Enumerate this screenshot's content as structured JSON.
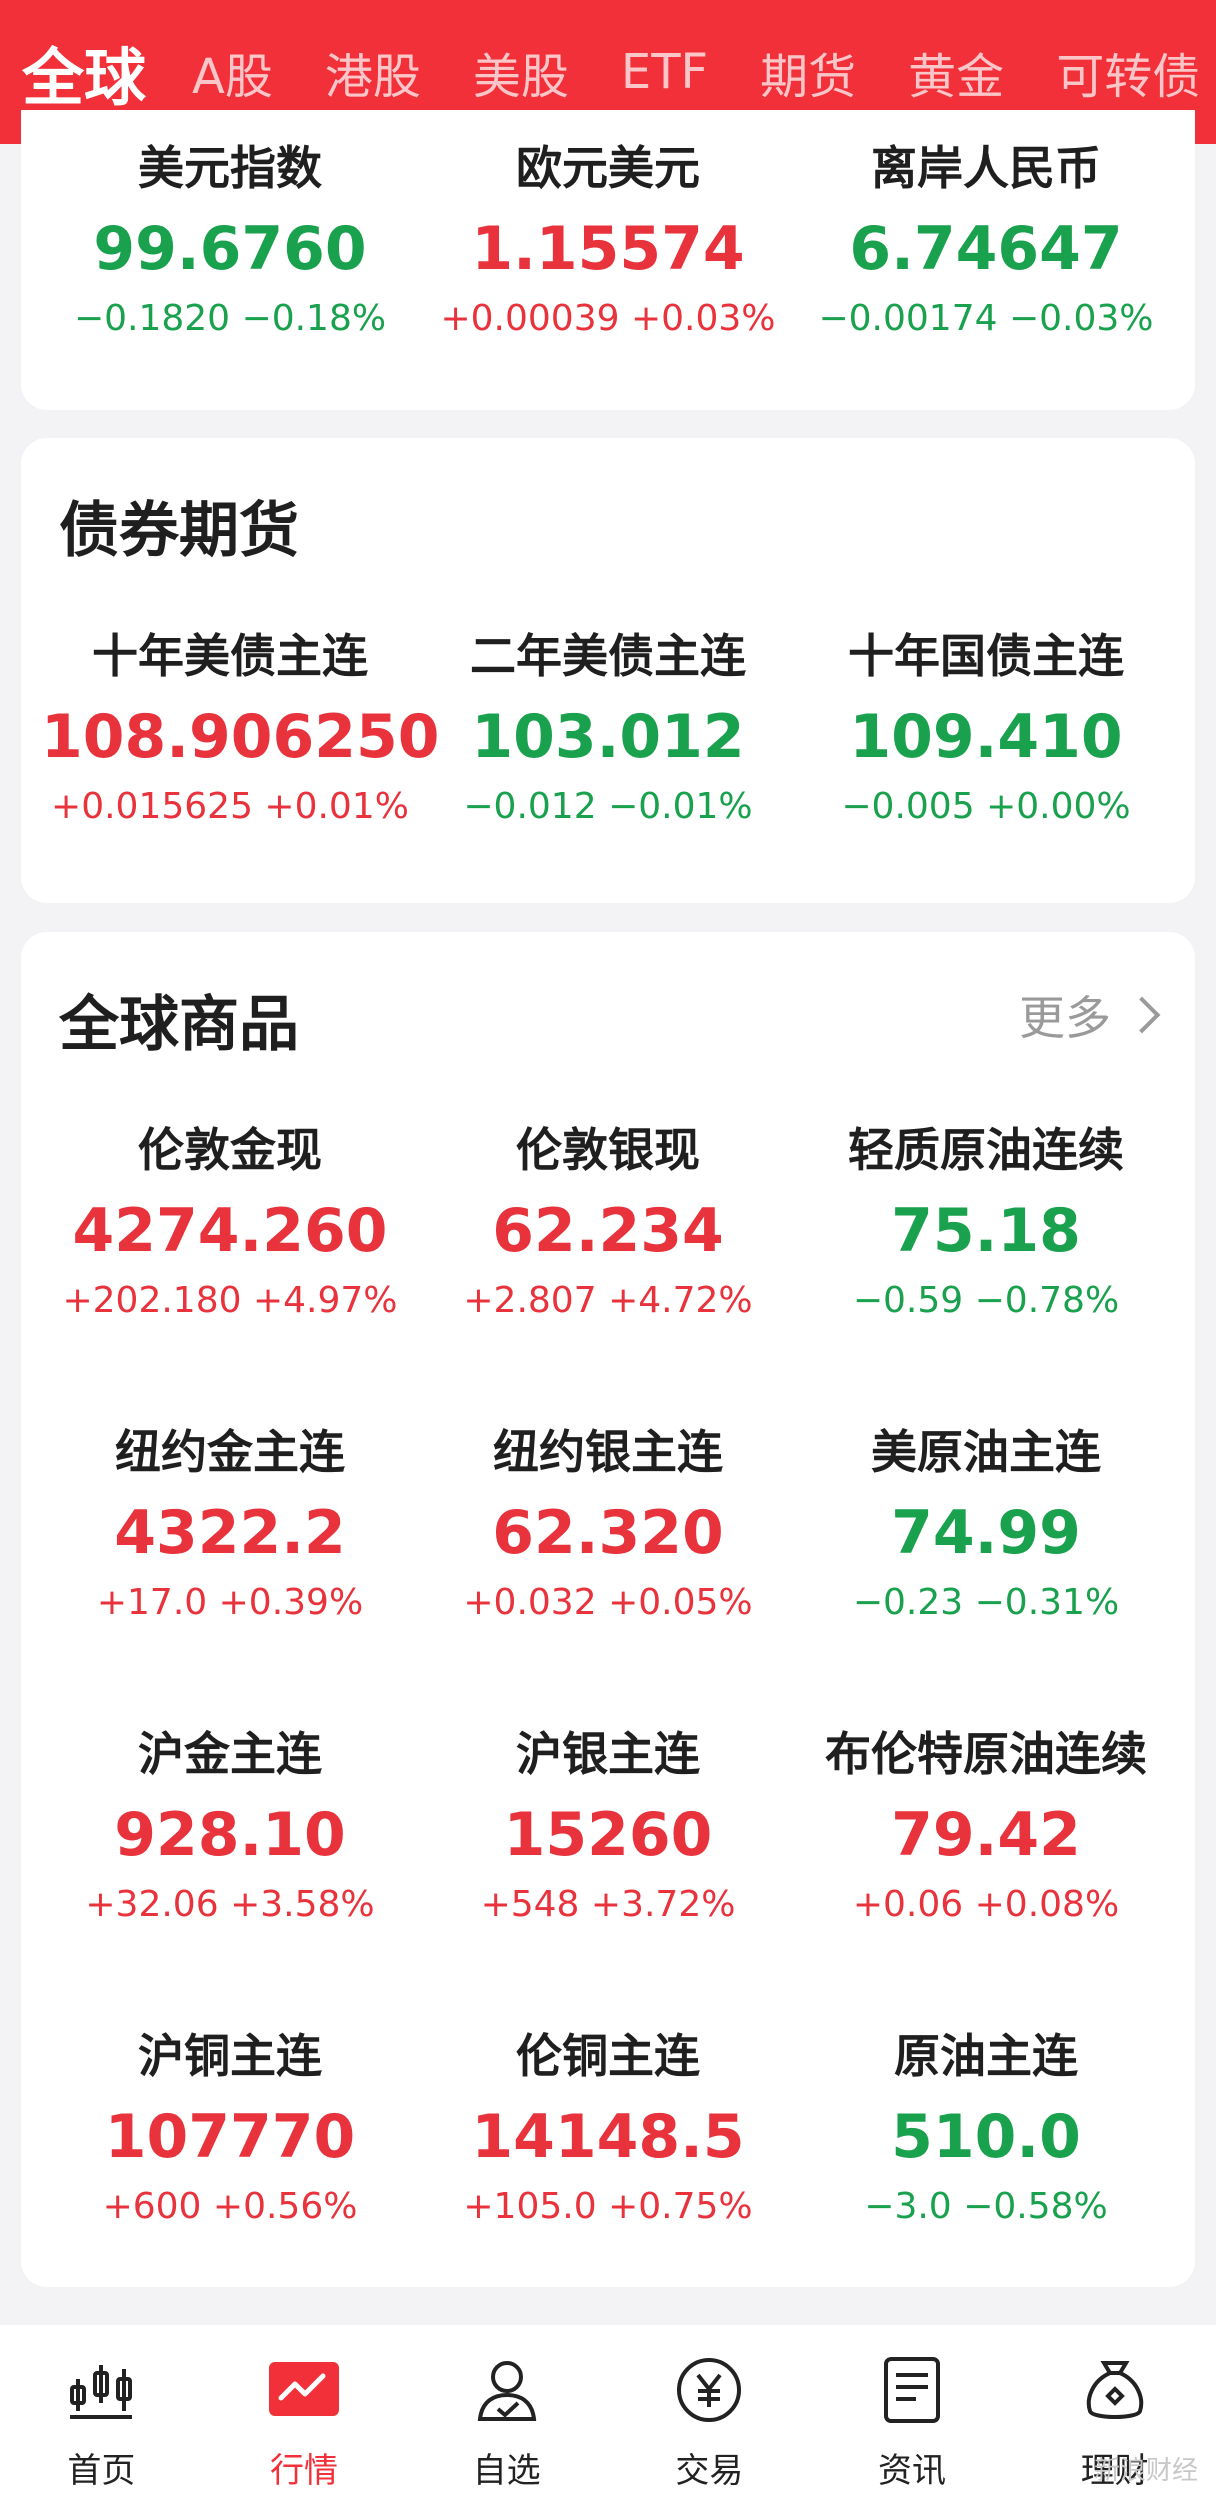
{
  "tabs": [
    {
      "label": "全球",
      "active": true
    },
    {
      "label": "A股"
    },
    {
      "label": "港股"
    },
    {
      "label": "美股"
    },
    {
      "label": "ETF"
    },
    {
      "label": "期货"
    },
    {
      "label": "黄金"
    },
    {
      "label": "可转债"
    }
  ],
  "currency": {
    "items": [
      {
        "name": "美元指数",
        "price": "99.6760",
        "change": "−0.1820",
        "pct": "−0.18%",
        "dir": "down"
      },
      {
        "name": "欧元美元",
        "price": "1.15574",
        "change": "+0.00039",
        "pct": "+0.03%",
        "dir": "up"
      },
      {
        "name": "离岸人民币",
        "price": "6.74647",
        "change": "−0.00174",
        "pct": "−0.03%",
        "dir": "down"
      }
    ]
  },
  "bonds": {
    "title": "债券期货",
    "items": [
      {
        "name": "十年美债主连",
        "price": "108.906250",
        "change": "+0.015625",
        "pct": "+0.01%",
        "dir": "up"
      },
      {
        "name": "二年美债主连",
        "price": "103.012",
        "change": "−0.012",
        "pct": "−0.01%",
        "dir": "down"
      },
      {
        "name": "十年国债主连",
        "price": "109.410",
        "change": "−0.005",
        "pct": "+0.00%",
        "dir": "down"
      }
    ]
  },
  "commodities": {
    "title": "全球商品",
    "more_label": "更多",
    "items": [
      {
        "name": "伦敦金现",
        "price": "4274.260",
        "change": "+202.180",
        "pct": "+4.97%",
        "dir": "up"
      },
      {
        "name": "伦敦银现",
        "price": "62.234",
        "change": "+2.807",
        "pct": "+4.72%",
        "dir": "up"
      },
      {
        "name": "轻质原油连续",
        "price": "75.18",
        "change": "−0.59",
        "pct": "−0.78%",
        "dir": "down"
      },
      {
        "name": "纽约金主连",
        "price": "4322.2",
        "change": "+17.0",
        "pct": "+0.39%",
        "dir": "up"
      },
      {
        "name": "纽约银主连",
        "price": "62.320",
        "change": "+0.032",
        "pct": "+0.05%",
        "dir": "up"
      },
      {
        "name": "美原油主连",
        "price": "74.99",
        "change": "−0.23",
        "pct": "−0.31%",
        "dir": "down"
      },
      {
        "name": "沪金主连",
        "price": "928.10",
        "change": "+32.06",
        "pct": "+3.58%",
        "dir": "up"
      },
      {
        "name": "沪银主连",
        "price": "15260",
        "change": "+548",
        "pct": "+3.72%",
        "dir": "up"
      },
      {
        "name": "布伦特原油连续",
        "price": "79.42",
        "change": "+0.06",
        "pct": "+0.08%",
        "dir": "up"
      },
      {
        "name": "沪铜主连",
        "price": "107770",
        "change": "+600",
        "pct": "+0.56%",
        "dir": "up"
      },
      {
        "name": "伦铜主连",
        "price": "14148.5",
        "change": "+105.0",
        "pct": "+0.75%",
        "dir": "up"
      },
      {
        "name": "原油主连",
        "price": "510.0",
        "change": "−3.0",
        "pct": "−0.58%",
        "dir": "down"
      }
    ]
  },
  "nav": [
    {
      "label": "首页",
      "icon": "candlestick-icon"
    },
    {
      "label": "行情",
      "icon": "market-chart-icon",
      "active": true
    },
    {
      "label": "自选",
      "icon": "user-check-icon"
    },
    {
      "label": "交易",
      "icon": "yuan-coin-icon"
    },
    {
      "label": "资讯",
      "icon": "document-icon"
    },
    {
      "label": "理财",
      "icon": "money-bag-icon"
    }
  ],
  "watermark": "新浪财经",
  "colors": {
    "brand": "#f2303a",
    "up": "#e8323c",
    "down": "#19a14e"
  }
}
